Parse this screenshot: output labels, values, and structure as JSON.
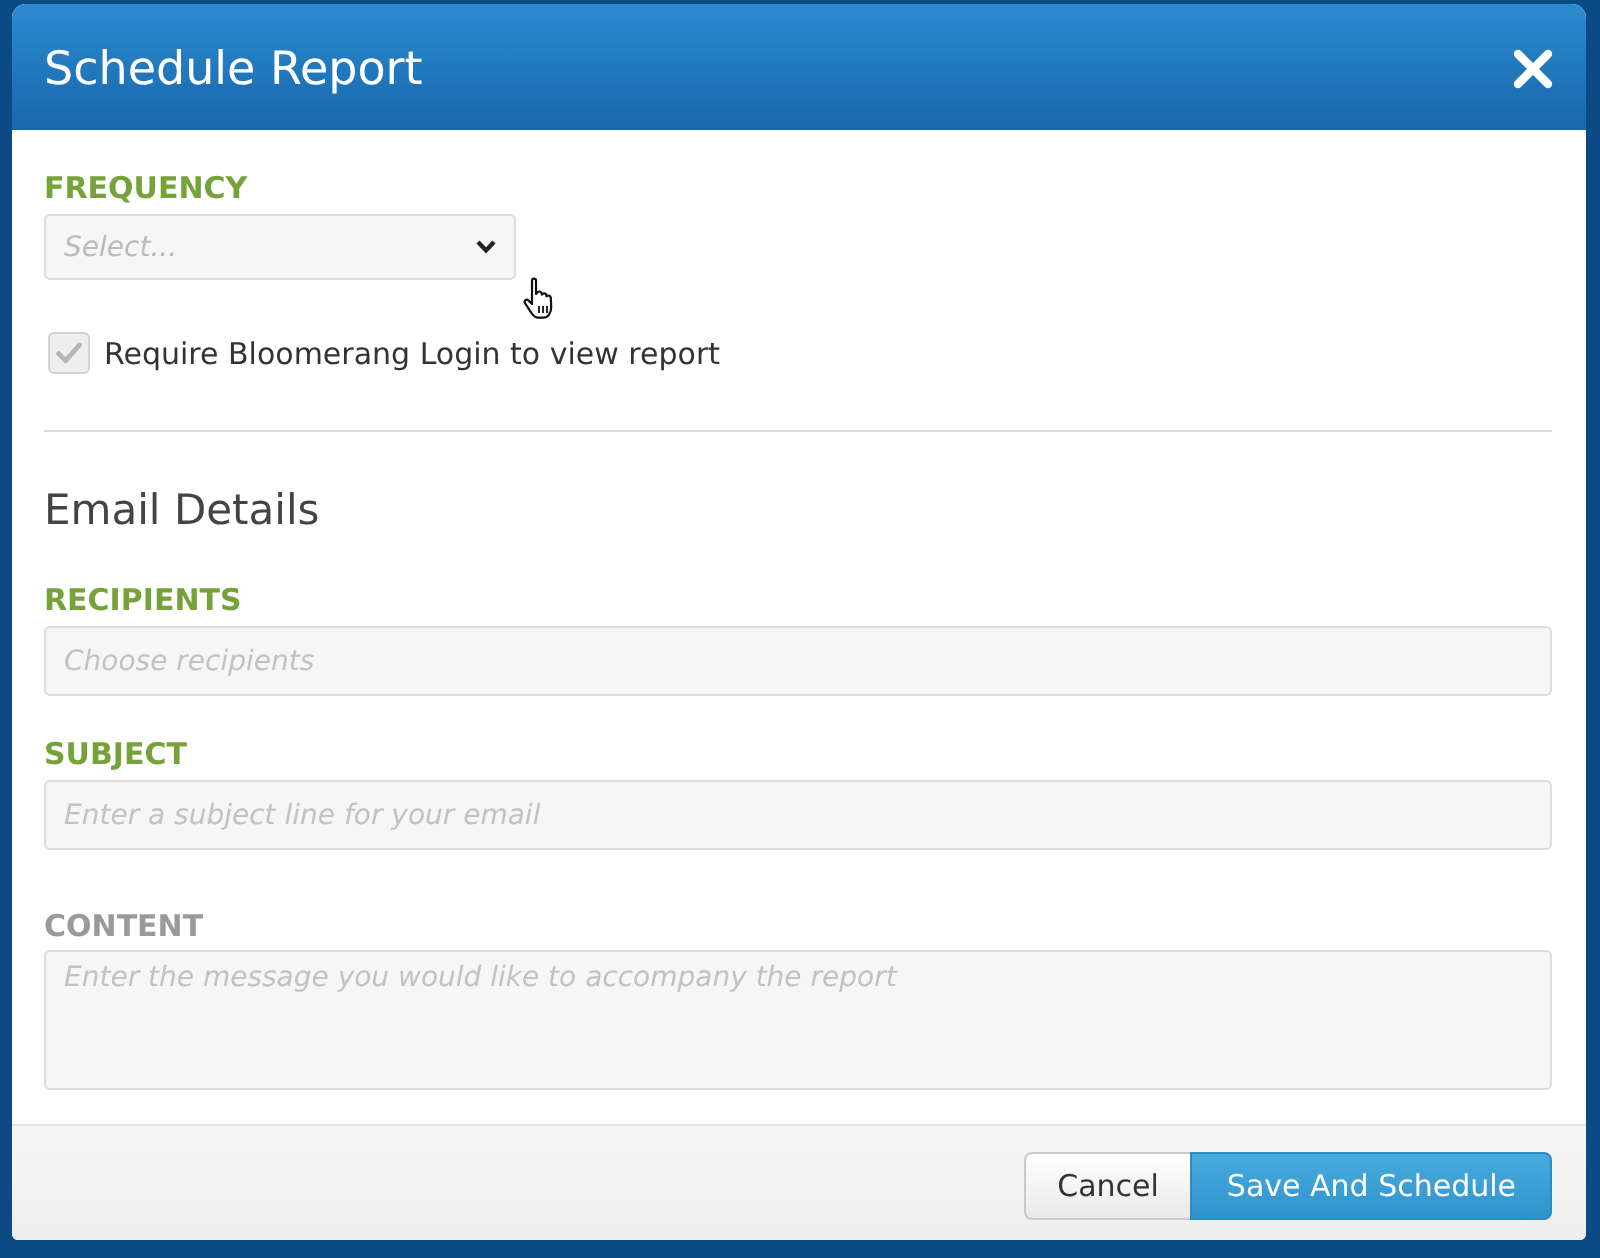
{
  "dialog": {
    "title": "Schedule Report"
  },
  "frequency": {
    "label": "FREQUENCY",
    "placeholder": "Select...",
    "required": true
  },
  "login_option": {
    "label": "Require Bloomerang Login to view report",
    "checked": true,
    "disabled": true
  },
  "section_title": "Email Details",
  "fields": [
    {
      "kind": "text",
      "label": "RECIPIENTS",
      "placeholder": "Choose recipients",
      "required": true
    },
    {
      "kind": "text",
      "label": "SUBJECT",
      "placeholder": "Enter a subject line for your email",
      "required": true
    },
    {
      "kind": "textarea",
      "label": "CONTENT",
      "placeholder": "Enter the message you would like to accompany the report",
      "required": false
    }
  ],
  "buttons": [
    {
      "kind": "secondary",
      "label": "Cancel"
    },
    {
      "kind": "primary",
      "label": "Save And Schedule"
    }
  ]
}
